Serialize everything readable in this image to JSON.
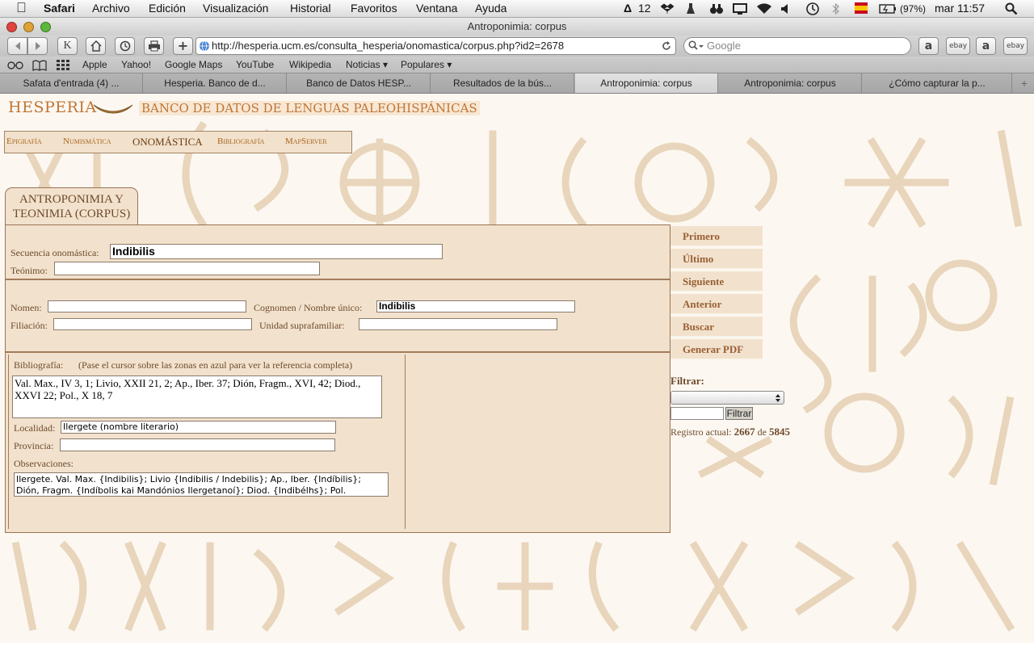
{
  "menubar": {
    "app": "Safari",
    "items": [
      "Archivo",
      "Edición",
      "Visualización",
      "Historial",
      "Favoritos",
      "Ventana",
      "Ayuda"
    ],
    "status": {
      "adobe": "12",
      "battery": "(97%)",
      "clock": "mar 11:57"
    }
  },
  "window": {
    "title": "Antroponimia: corpus"
  },
  "toolbar": {
    "k_button": "K",
    "url": "http://hesperia.ucm.es/consulta_hesperia/onomastica/corpus.php?id2=2678",
    "search_placeholder": "Google",
    "ext": [
      "a",
      "ebay",
      "a",
      "ebay"
    ]
  },
  "bookmarks": [
    "Apple",
    "Yahoo!",
    "Google Maps",
    "YouTube",
    "Wikipedia",
    "Noticias ▾",
    "Populares ▾"
  ],
  "tabs": [
    {
      "label": "Safata d'entrada (4) ..."
    },
    {
      "label": "Hesperia. Banco de d..."
    },
    {
      "label": "Banco de Datos HESP..."
    },
    {
      "label": "Resultados de la bús..."
    },
    {
      "label": "Antroponimia: corpus"
    },
    {
      "label": "Antroponimia: corpus"
    },
    {
      "label": "¿Cómo capturar la p..."
    }
  ],
  "page": {
    "logo": {
      "name": "HESPERIA",
      "subtitle": "BANCO DE DATOS DE LENGUAS PALEOHISPÁNICAS"
    },
    "nav": [
      "Epigrafía",
      "Numismática",
      "ONOMÁSTICA",
      "Bibliografía",
      "MapServer"
    ],
    "section_title": "ANTROPONIMIA Y TEONIMIA (CORPUS)",
    "fields": {
      "secuencia_label": "Secuencia onomástica:",
      "secuencia_value": "Indibilis",
      "teonimo_label": "Teónimo:",
      "teonimo_value": "",
      "nomen_label": "Nomen:",
      "nomen_value": "",
      "cognomen_label": "Cognomen / Nombre único:",
      "cognomen_value": "Indibilis",
      "filiacion_label": "Filiación:",
      "filiacion_value": "",
      "unidad_label": "Unidad suprafamiliar:",
      "unidad_value": "",
      "biblio_label": "Bibliografía:",
      "biblio_hint": "(Pase el cursor sobre las zonas en azul para ver la referencia completa)",
      "biblio_value": "Val. Max., IV 3, 1; Livio, XXII 21, 2; Ap., Iber. 37; Dión, Fragm., XVI, 42; Diod., XXVI 22; Pol., X 18, 7",
      "localidad_label": "Localidad:",
      "localidad_value": "Ilergete (nombre literario)",
      "provincia_label": "Provincia:",
      "provincia_value": "",
      "observaciones_label": "Observaciones:",
      "observaciones_value": "Ilergete. Val. Max. {Indibilis}; Livio {Indibilis / Indebilis}; Ap., Iber. {Indíbilis}; Dión, Fragm. {Indíbolis kai Mandónios Ilergetanoí}; Diod. {Indibélhs}; Pol."
    },
    "sidenav": [
      "Primero",
      "Último",
      "Siguiente",
      "Anterior",
      "Buscar",
      "Generar PDF"
    ],
    "filter": {
      "label": "Filtrar:",
      "button": "Filtrar"
    },
    "record": {
      "prefix": "Registro actual:",
      "current": "2667",
      "sep": "de",
      "total": "5845"
    }
  }
}
